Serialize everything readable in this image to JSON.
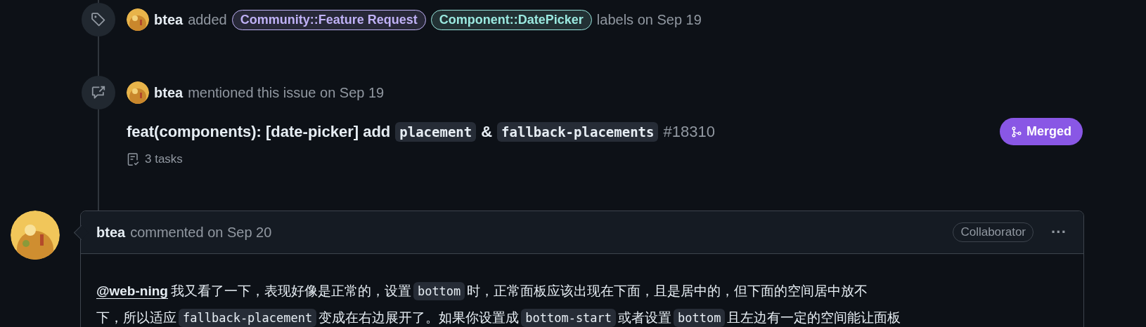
{
  "timeline": [
    {
      "kind": "labeled",
      "author": "btea",
      "action": "added",
      "labels": [
        {
          "name": "Community::Feature Request",
          "color": "#bfb1f5"
        },
        {
          "name": "Component::DatePicker",
          "color": "#9ae8df"
        }
      ],
      "suffix": "labels on Sep 19"
    },
    {
      "kind": "mentioned",
      "author": "btea",
      "action": "mentioned this issue on Sep 19",
      "title": [
        {
          "kind": "text",
          "text": "feat(components): [date-picker] add"
        },
        {
          "kind": "code",
          "text": "placement"
        },
        {
          "kind": "text",
          "text": "&"
        },
        {
          "kind": "code",
          "text": "fallback-placements"
        },
        {
          "kind": "number",
          "text": "#18310"
        }
      ],
      "tasks": "3 tasks",
      "status": "Merged"
    }
  ],
  "comment": {
    "author": "btea",
    "meta": "commented on Sep 20",
    "role": "Collaborator",
    "menu": "···",
    "lines": [
      [
        {
          "kind": "mention",
          "text": "@web-ning"
        },
        {
          "kind": "text",
          "text": "我又看了一下，表现好像是正常的，设置"
        },
        {
          "kind": "code",
          "text": "bottom"
        },
        {
          "kind": "text",
          "text": "时，正常面板应该出现在下面，且是居中的，但下面的空间居中放不"
        }
      ],
      [
        {
          "kind": "text",
          "text": "下，所以适应"
        },
        {
          "kind": "code",
          "text": "fallback-placement"
        },
        {
          "kind": "text",
          "text": "变成在右边展开了。如果你设置成"
        },
        {
          "kind": "code",
          "text": "bottom-start"
        },
        {
          "kind": "text",
          "text": "或者设置"
        },
        {
          "kind": "code",
          "text": "bottom"
        },
        {
          "kind": "text",
          "text": "且左边有一定的空间能让面板"
        }
      ]
    ]
  }
}
